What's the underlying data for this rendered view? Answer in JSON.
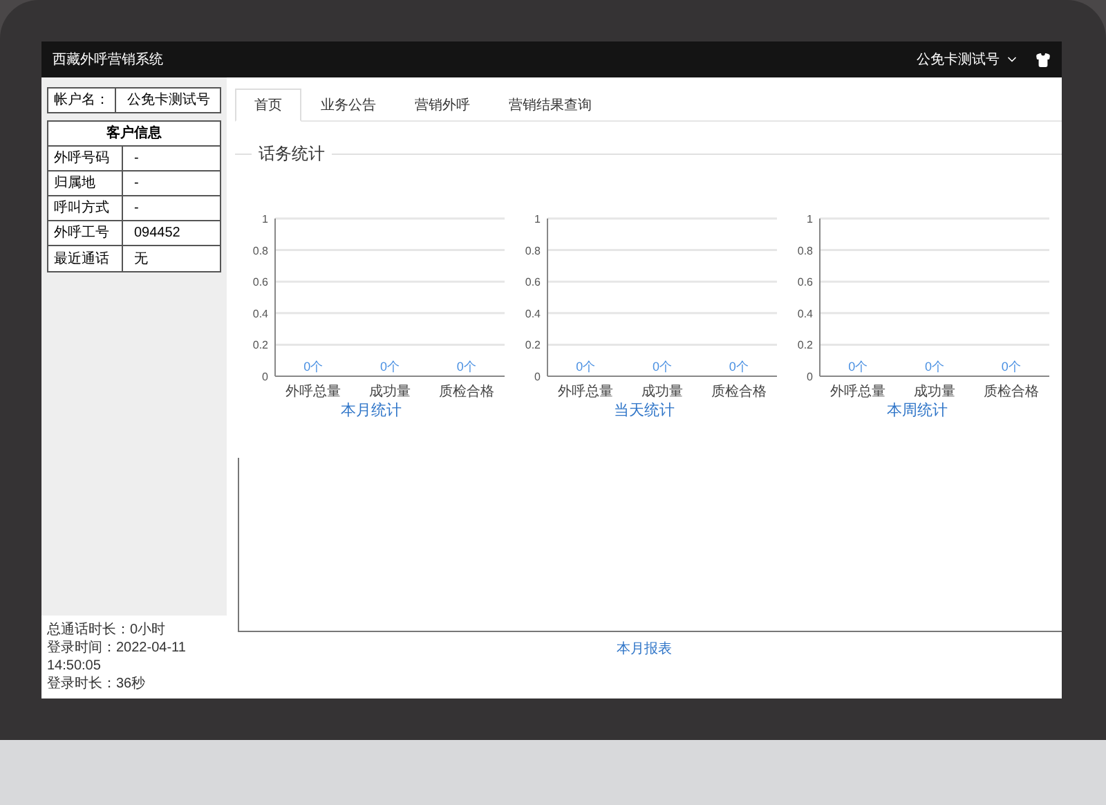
{
  "header": {
    "title": "西藏外呼营销系统",
    "user": "公免卡测试号"
  },
  "sidebar": {
    "account": {
      "label": "帐户名：",
      "value": "公免卡测试号"
    },
    "customer_info": {
      "title": "客户信息",
      "rows": [
        {
          "label": "外呼号码",
          "value": "-"
        },
        {
          "label": "归属地",
          "value": "-"
        },
        {
          "label": "呼叫方式",
          "value": "-"
        },
        {
          "label": "外呼工号",
          "value": "094452"
        },
        {
          "label": "最近通话",
          "value": "无"
        }
      ]
    },
    "footer": [
      "总通话时长：0小时",
      "登录时间：2022-04-11 14:50:05",
      "登录时长：36秒"
    ]
  },
  "tabs": [
    {
      "label": "首页",
      "selected": true
    },
    {
      "label": "业务公告",
      "selected": false
    },
    {
      "label": "营销外呼",
      "selected": false
    },
    {
      "label": "营销结果查询",
      "selected": false
    }
  ],
  "section_title": "话务统计",
  "charts": [
    {
      "chart_data": {
        "type": "bar",
        "grid": true,
        "title": "本月统计",
        "categories": [
          "外呼总量",
          "成功量",
          "质检合格"
        ],
        "values": [
          0,
          0,
          0
        ],
        "ylim": [
          0,
          1
        ],
        "yticks": [
          0,
          0.2,
          0.4,
          0.6,
          0.8,
          1
        ],
        "value_labels": [
          "0个",
          "0个",
          "0个"
        ]
      }
    },
    {
      "chart_data": {
        "type": "bar",
        "grid": true,
        "title": "当天统计",
        "categories": [
          "外呼总量",
          "成功量",
          "质检合格"
        ],
        "values": [
          0,
          0,
          0
        ],
        "ylim": [
          0,
          1
        ],
        "yticks": [
          0,
          0.2,
          0.4,
          0.6,
          0.8,
          1
        ],
        "value_labels": [
          "0个",
          "0个",
          "0个"
        ]
      }
    },
    {
      "chart_data": {
        "type": "bar",
        "grid": true,
        "title": "本周统计",
        "categories": [
          "外呼总量",
          "成功量",
          "质检合格"
        ],
        "values": [
          0,
          0,
          0
        ],
        "ylim": [
          0,
          1
        ],
        "yticks": [
          0,
          0.2,
          0.4,
          0.6,
          0.8,
          1
        ],
        "value_labels": [
          "0个",
          "0个",
          "0个"
        ]
      }
    }
  ],
  "report": {
    "title": "本月报表"
  }
}
